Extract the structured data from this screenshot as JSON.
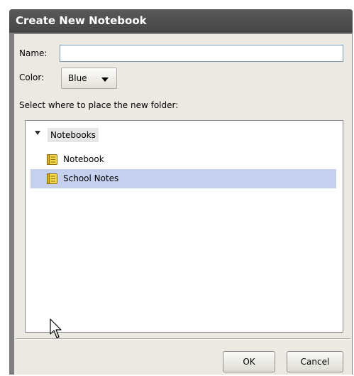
{
  "dialog": {
    "title": "Create New Notebook",
    "name_label": "Name:",
    "name_value": "",
    "color_label": "Color:",
    "color_value": "Blue",
    "location_label": "Select where to place the new folder:"
  },
  "tree": {
    "root": "Notebooks",
    "root_expanded": true,
    "items": [
      {
        "label": "Notebook",
        "icon": "notebook-icon",
        "selected": false
      },
      {
        "label": "School Notes",
        "icon": "notebook-icon",
        "selected": true
      }
    ]
  },
  "buttons": {
    "ok": "OK",
    "cancel": "Cancel"
  },
  "colors": {
    "title_bar": "#4f4f4f",
    "dialog_bg": "#ebe9e2",
    "selection": "#c5d0ee",
    "notebook_icon": "#f5d84a"
  }
}
